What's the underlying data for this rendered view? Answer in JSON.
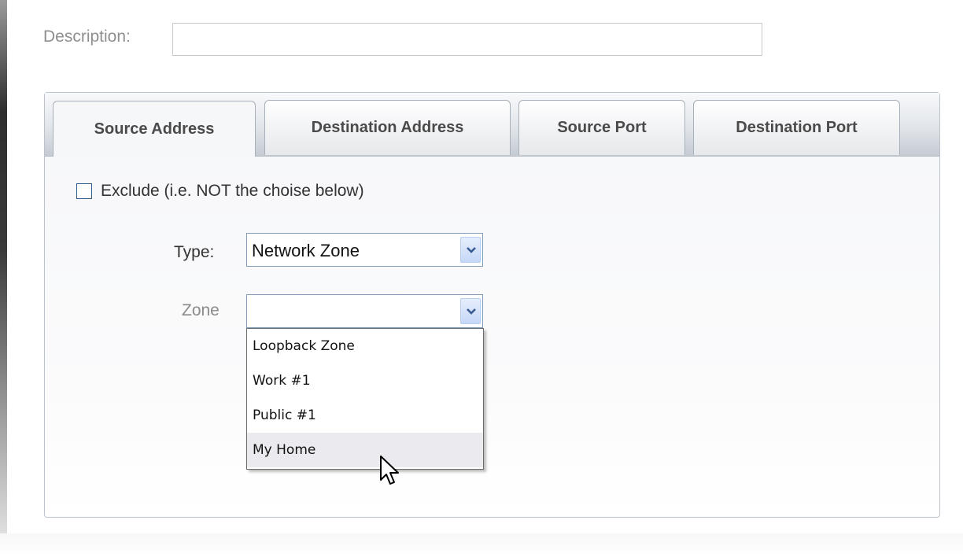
{
  "description": {
    "label": "Description:",
    "value": "",
    "placeholder": ""
  },
  "tabs": [
    {
      "label": "Source Address",
      "active": true
    },
    {
      "label": "Destination Address",
      "active": false
    },
    {
      "label": "Source Port",
      "active": false
    },
    {
      "label": "Destination Port",
      "active": false
    }
  ],
  "exclude": {
    "label": "Exclude (i.e. NOT the choise below)",
    "checked": false
  },
  "type_field": {
    "label": "Type:",
    "value": "Network Zone"
  },
  "zone_field": {
    "label": "Zone",
    "value": "",
    "options": [
      "Loopback Zone",
      "Work #1",
      "Public #1",
      "My Home"
    ],
    "hovered": "My Home"
  },
  "icons": {
    "dropdown": "chevron-down-icon",
    "cursor": "mouse-pointer-icon",
    "checkbox": "checkbox-unchecked-icon"
  },
  "colors": {
    "checkbox_border": "#2f5d8a",
    "dropdown_button": "#c6d8f7",
    "hover_row": "#ebebef"
  }
}
